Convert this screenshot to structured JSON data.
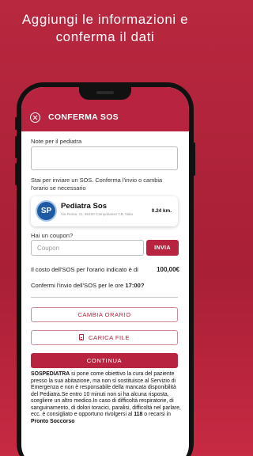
{
  "headline": {
    "line1": "Aggiungi le informazioni e",
    "line2": "conferma il dati"
  },
  "appbar": {
    "title": "CONFERMA SOS"
  },
  "form": {
    "notes_label": "Note per il pediatra",
    "notes_value": "",
    "sos_info": "Stai per inviare un SOS. Conferma l'invio o cambia l'orario se necessario",
    "coupon_label": "Hai un coupon?",
    "coupon_placeholder": "Coupon",
    "invia_label": "INVIA",
    "cost_label": "Il costo dell'SOS per l'orario indicato è di",
    "cost_value": "100,00€",
    "confirm_prefix": "Confermi l'invio dell'SOS per le ore",
    "confirm_time": "17:00?",
    "change_time_label": "CAMBIA ORARIO",
    "upload_label": "CARICA FILE",
    "continue_label": "CONTINUA"
  },
  "pediatrician": {
    "logo_text": "SP",
    "name": "Pediatra Sos",
    "address": "Via Roma, 11, 86100 Campobasso CB, Italia",
    "distance": "0.24 km."
  },
  "description": {
    "brand": "SOSPEDIATRA",
    "text1": " si pone come obiettivo la cura del paziente presso la sua abitazione, ma non si sostituisce al Servizio di Emergenza e non è responsabile della mancata disponibilità del Pediatra.Se entro 10 minuti non si ha alcuna risposta, scegliere un altro medico.In caso di difficoltà respiratorie, di sanguinamento, di dolori toracici, paralisi, difficoltà nel parlare, ecc. è consigliato e opportuno rivolgersi al ",
    "emergency_number": "118",
    "text2": " o recarsi in ",
    "er_name": "Pronto Soccorso"
  },
  "colors": {
    "brand_red": "#b8233f",
    "logo_blue": "#1f5aa5"
  },
  "icons": [
    "close-circle-icon",
    "file-icon"
  ]
}
